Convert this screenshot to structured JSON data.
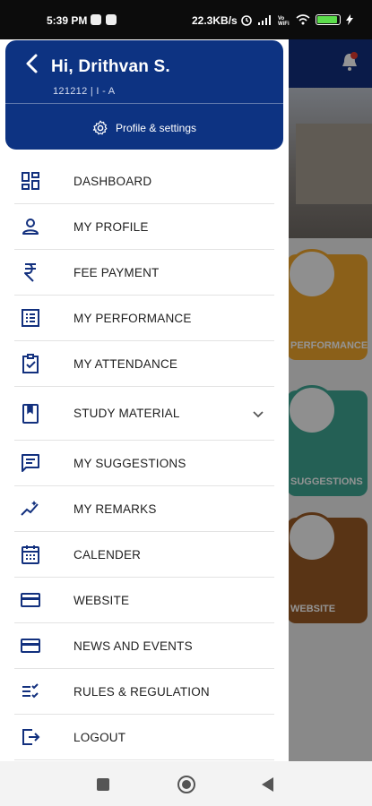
{
  "status_bar": {
    "time": "5:39 PM",
    "net_speed": "22.3KB/s",
    "battery_level": 0.85
  },
  "drawer": {
    "greeting": "Hi, Drithvan S.",
    "subinfo": "121212  |  I - A",
    "profile_settings": "Profile & settings",
    "menu": [
      {
        "label": "DASHBOARD",
        "icon": "dashboard-icon"
      },
      {
        "label": "MY PROFILE",
        "icon": "person-icon"
      },
      {
        "label": "FEE PAYMENT",
        "icon": "rupee-icon"
      },
      {
        "label": "MY PERFORMANCE",
        "icon": "list-icon"
      },
      {
        "label": "MY ATTENDANCE",
        "icon": "clipboard-check-icon"
      },
      {
        "label": "STUDY MATERIAL",
        "icon": "book-icon",
        "expandable": true
      },
      {
        "label": "MY SUGGESTIONS",
        "icon": "chat-icon"
      },
      {
        "label": "MY REMARKS",
        "icon": "trend-icon"
      },
      {
        "label": "CALENDER",
        "icon": "calendar-icon"
      },
      {
        "label": "WEBSITE",
        "icon": "card-icon"
      },
      {
        "label": "NEWS AND EVENTS",
        "icon": "card-icon"
      },
      {
        "label": "RULES & REGULATION",
        "icon": "checklist-icon"
      },
      {
        "label": "LOGOUT",
        "icon": "logout-icon"
      }
    ]
  },
  "background": {
    "tiles": [
      "PERFORMANCE",
      "SUGGESTIONS",
      "WEBSITE"
    ]
  },
  "colors": {
    "primary": "#0d3382",
    "icon": "#12307e",
    "performance": "#f0a52b",
    "suggestions": "#3ea693",
    "website": "#9a5a25"
  },
  "navbar": {
    "buttons": [
      "recent-apps",
      "home",
      "back"
    ]
  }
}
